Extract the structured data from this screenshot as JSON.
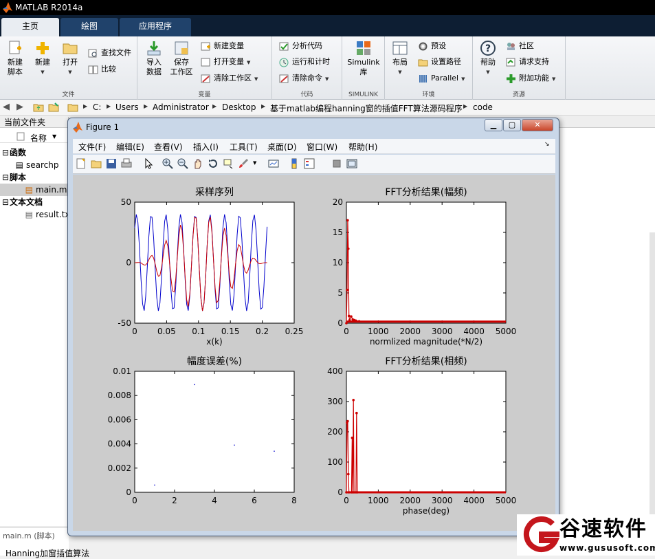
{
  "app": {
    "title": "MATLAB R2014a"
  },
  "ribbon_tabs": [
    "主页",
    "绘图",
    "应用程序"
  ],
  "ribbon": {
    "file_group": {
      "label": "文件",
      "new_script": "新建\n脚本",
      "new": "新建",
      "open": "打开",
      "find_files": "查找文件",
      "compare": "比较"
    },
    "variable_group": {
      "label": "变量",
      "import": "导入\n数据",
      "save_workspace": "保存\n工作区",
      "new_variable": "新建变量",
      "open_variable": "打开变量",
      "clear_workspace": "清除工作区"
    },
    "code_group": {
      "label": "代码",
      "analyze": "分析代码",
      "run_time": "运行和计时",
      "clear_commands": "清除命令"
    },
    "simulink_group": {
      "label": "SIMULINK",
      "simulink": "Simulink\n库"
    },
    "env_group": {
      "label": "环境",
      "layout": "布局",
      "preferences": "预设",
      "set_path": "设置路径",
      "parallel": "Parallel"
    },
    "resources_group": {
      "label": "资源",
      "help": "帮助",
      "community": "社区",
      "support": "请求支持",
      "addons": "附加功能"
    }
  },
  "address": [
    "C:",
    "Users",
    "Administrator",
    "Desktop",
    "基于matlab编程hanning窗的插值FFT算法源码程序",
    "code"
  ],
  "current_folder": {
    "title": "当前文件夹",
    "column": "名称",
    "tree": [
      {
        "label": "函数",
        "type": "section"
      },
      {
        "label": "searchp",
        "type": "file"
      },
      {
        "label": "脚本",
        "type": "section"
      },
      {
        "label": "main.m",
        "type": "file",
        "selected": true
      },
      {
        "label": "文本文档",
        "type": "section"
      },
      {
        "label": "result.tx",
        "type": "file"
      }
    ],
    "detail_title": "main.m (脚本)",
    "detail_text": "Hanning加窗插值算法"
  },
  "figure": {
    "title": "Figure 1",
    "menus": [
      "文件(F)",
      "编辑(E)",
      "查看(V)",
      "插入(I)",
      "工具(T)",
      "桌面(D)",
      "窗口(W)",
      "帮助(H)"
    ],
    "toolbar_icons": [
      "new-figure-icon",
      "open-icon",
      "save-icon",
      "print-icon",
      "pointer-icon",
      "zoom-in-icon",
      "zoom-out-icon",
      "pan-icon",
      "rotate-icon",
      "data-cursor-icon",
      "brush-icon",
      "link-icon",
      "colorbar-icon",
      "legend-icon",
      "hide-plot-tools-icon",
      "show-plot-tools-icon"
    ]
  },
  "chart_data": [
    {
      "type": "line",
      "title": "采样序列",
      "xlabel": "x(k)",
      "ylabel": "",
      "xlim": [
        0,
        0.25
      ],
      "ylim": [
        -50,
        50
      ],
      "xticks": [
        0,
        0.05,
        0.1,
        0.15,
        0.2,
        0.25
      ],
      "yticks": [
        -50,
        0,
        50
      ],
      "series": [
        {
          "color": "#0000cc",
          "x_range": [
            0,
            0.2075
          ],
          "description": "sampled sinusoid, amplitude ~40, ~9 cycles"
        },
        {
          "color": "#cc0000",
          "x_range": [
            0,
            0.2075
          ],
          "description": "Hanning-windowed sequence"
        }
      ]
    },
    {
      "type": "line",
      "title": "FFT分析结果(幅频)",
      "xlabel": "normlized magnitude(*N/2)",
      "ylabel": "",
      "xlim": [
        0,
        5000
      ],
      "ylim": [
        0,
        20
      ],
      "xticks": [
        0,
        1000,
        2000,
        3000,
        4000,
        5000
      ],
      "yticks": [
        0,
        5,
        10,
        15,
        20
      ],
      "series": [
        {
          "color": "#cc0000",
          "points": [
            [
              0,
              0
            ],
            [
              20,
              5.5
            ],
            [
              40,
              17
            ],
            [
              60,
              12.3
            ],
            [
              80,
              1.2
            ],
            [
              100,
              0.5
            ],
            [
              150,
              1.1
            ],
            [
              200,
              0.6
            ],
            [
              250,
              0.5
            ],
            [
              300,
              0.4
            ],
            [
              400,
              0.3
            ],
            [
              600,
              0.25
            ],
            [
              5000,
              0.25
            ]
          ]
        }
      ]
    },
    {
      "type": "scatter",
      "title": "幅度误差(%)",
      "xlabel": "",
      "ylabel": "",
      "xlim": [
        0,
        8
      ],
      "ylim": [
        0,
        0.01
      ],
      "xticks": [
        0,
        2,
        4,
        6,
        8
      ],
      "yticks": [
        0,
        0.002,
        0.004,
        0.006,
        0.008,
        0.01
      ],
      "series": [
        {
          "color": "#0000cc",
          "points": [
            [
              1,
              0.0006
            ],
            [
              3,
              0.0089
            ],
            [
              5,
              0.0039
            ],
            [
              7,
              0.0034
            ]
          ]
        }
      ]
    },
    {
      "type": "line",
      "title": "FFT分析结果(相频)",
      "xlabel": "phase(deg)",
      "ylabel": "",
      "xlim": [
        0,
        5000
      ],
      "ylim": [
        0,
        400
      ],
      "xticks": [
        0,
        1000,
        2000,
        3000,
        4000,
        5000
      ],
      "yticks": [
        0,
        100,
        200,
        300,
        400
      ],
      "series": [
        {
          "color": "#cc0000",
          "points": [
            [
              0,
              0
            ],
            [
              20,
              230
            ],
            [
              40,
              235
            ],
            [
              60,
              60
            ],
            [
              80,
              0
            ],
            [
              160,
              0
            ],
            [
              180,
              180
            ],
            [
              200,
              0
            ],
            [
              220,
              305
            ],
            [
              240,
              0
            ],
            [
              300,
              0
            ],
            [
              320,
              262
            ],
            [
              340,
              0
            ],
            [
              5000,
              0
            ]
          ]
        }
      ]
    }
  ],
  "watermark": {
    "text": "谷速软件",
    "url": "www.gususoft.com"
  }
}
